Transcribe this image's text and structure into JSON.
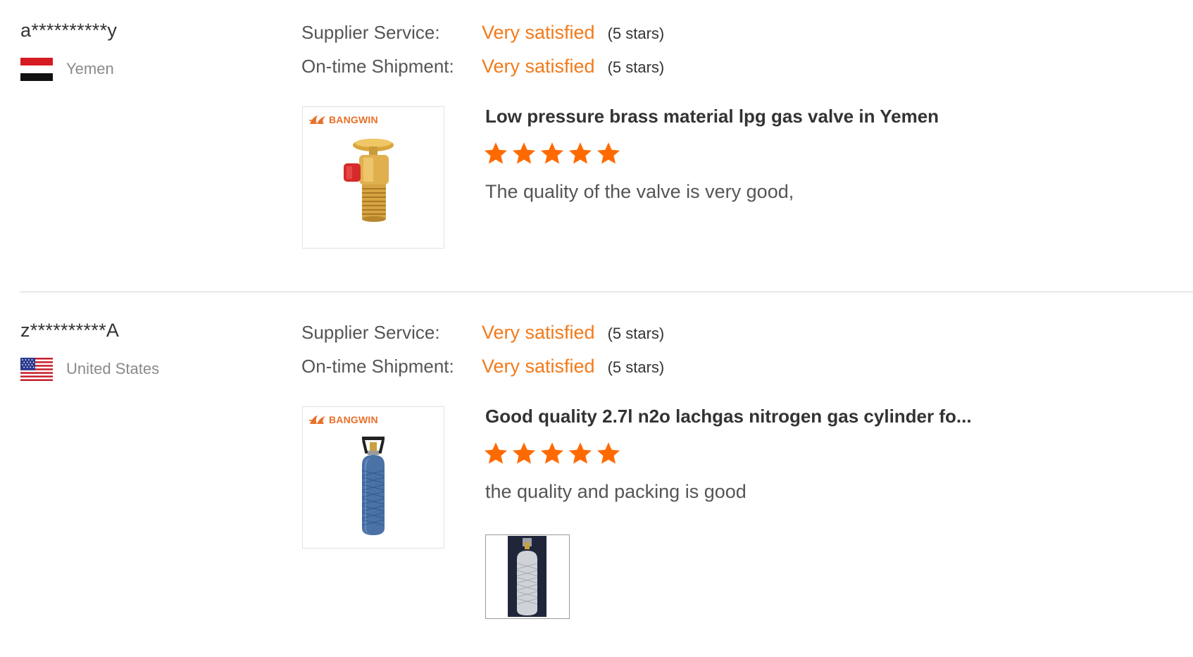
{
  "colors": {
    "accent": "#f27a1a",
    "star": "#ff6a00"
  },
  "reviews": [
    {
      "user": "a**********y",
      "country": "Yemen",
      "flag_icon": "yemen-flag-icon",
      "ratings": [
        {
          "label": "Supplier Service:",
          "value": "Very satisfied",
          "stars_text": "(5 stars)"
        },
        {
          "label": "On-time Shipment:",
          "value": "Very satisfied",
          "stars_text": "(5 stars)"
        }
      ],
      "product": {
        "brand": "BANGWIN",
        "image_icon": "brass-gas-valve-image",
        "title": "Low pressure brass material lpg gas valve in Yemen",
        "rating": 5,
        "comment": "The quality of the valve is very good,"
      }
    },
    {
      "user": "z**********A",
      "country": "United States",
      "flag_icon": "us-flag-icon",
      "ratings": [
        {
          "label": "Supplier Service:",
          "value": "Very satisfied",
          "stars_text": "(5 stars)"
        },
        {
          "label": "On-time Shipment:",
          "value": "Very satisfied",
          "stars_text": "(5 stars)"
        }
      ],
      "product": {
        "brand": "BANGWIN",
        "image_icon": "blue-gas-cylinder-image",
        "title": "Good quality 2.7l n2o lachgas nitrogen gas cylinder fo...",
        "rating": 5,
        "comment": "the quality and packing is good",
        "attachment_icon": "cylinder-photo-thumbnail"
      }
    }
  ]
}
